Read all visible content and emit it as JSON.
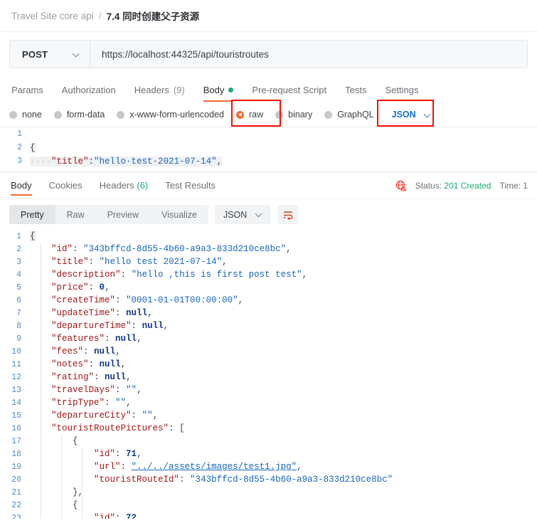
{
  "breadcrumb": {
    "root": "Travel Site core api",
    "separator": "/",
    "current": "7.4 同时创建父子资源"
  },
  "request": {
    "method": "POST",
    "url": "https://localhost:44325/api/touristroutes",
    "tabs": [
      {
        "label": "Params",
        "active": false
      },
      {
        "label": "Authorization",
        "active": false
      },
      {
        "label": "Headers",
        "count": "(9)",
        "active": false
      },
      {
        "label": "Body",
        "active": true,
        "dot": true
      },
      {
        "label": "Pre-request Script",
        "active": false
      },
      {
        "label": "Tests",
        "active": false
      },
      {
        "label": "Settings",
        "active": false
      }
    ],
    "body_types": [
      {
        "label": "none",
        "selected": false
      },
      {
        "label": "form-data",
        "selected": false
      },
      {
        "label": "x-www-form-urlencoded",
        "selected": false
      },
      {
        "label": "raw",
        "selected": true
      },
      {
        "label": "binary",
        "selected": false
      },
      {
        "label": "GraphQL",
        "selected": false
      }
    ],
    "format_selected": "JSON",
    "editor_lines": [
      {
        "num": "1",
        "text": ""
      },
      {
        "num": "2",
        "text": "{"
      },
      {
        "num": "3",
        "indent": "····",
        "key": "\"title\"",
        "colon": ":",
        "value": "\"hello·test·2021-07-14\"",
        "comma": ","
      }
    ]
  },
  "response": {
    "tabs": [
      {
        "label": "Body",
        "active": true
      },
      {
        "label": "Cookies",
        "active": false
      },
      {
        "label": "Headers",
        "count": "(6)",
        "active": false
      },
      {
        "label": "Test Results",
        "active": false
      }
    ],
    "status_prefix": "Status: ",
    "status_value": "201 Created",
    "time_text": "Time: 1",
    "view_modes": [
      {
        "label": "Pretty",
        "active": true
      },
      {
        "label": "Raw",
        "active": false
      },
      {
        "label": "Preview",
        "active": false
      },
      {
        "label": "Visualize",
        "active": false
      }
    ],
    "format_selected": "JSON",
    "lines": [
      {
        "num": "1",
        "tokens": [
          {
            "t": "{",
            "c": "p brace-hl"
          }
        ]
      },
      {
        "num": "2",
        "tokens": [
          {
            "t": "    ",
            "c": "p"
          },
          {
            "t": "\"id\"",
            "c": "k"
          },
          {
            "t": ": ",
            "c": "p"
          },
          {
            "t": "\"343bffcd-8d55-4b60-a9a3-833d210ce8bc\"",
            "c": "s"
          },
          {
            "t": ",",
            "c": "p"
          }
        ]
      },
      {
        "num": "3",
        "tokens": [
          {
            "t": "    ",
            "c": "p"
          },
          {
            "t": "\"title\"",
            "c": "k"
          },
          {
            "t": ": ",
            "c": "p"
          },
          {
            "t": "\"hello test 2021-07-14\"",
            "c": "s"
          },
          {
            "t": ",",
            "c": "p"
          }
        ]
      },
      {
        "num": "4",
        "tokens": [
          {
            "t": "    ",
            "c": "p"
          },
          {
            "t": "\"description\"",
            "c": "k"
          },
          {
            "t": ": ",
            "c": "p"
          },
          {
            "t": "\"hello ,this is first post test\"",
            "c": "s"
          },
          {
            "t": ",",
            "c": "p"
          }
        ]
      },
      {
        "num": "5",
        "tokens": [
          {
            "t": "    ",
            "c": "p"
          },
          {
            "t": "\"price\"",
            "c": "k"
          },
          {
            "t": ": ",
            "c": "p"
          },
          {
            "t": "0",
            "c": "n"
          },
          {
            "t": ",",
            "c": "p"
          }
        ]
      },
      {
        "num": "6",
        "tokens": [
          {
            "t": "    ",
            "c": "p"
          },
          {
            "t": "\"createTime\"",
            "c": "k"
          },
          {
            "t": ": ",
            "c": "p"
          },
          {
            "t": "\"0001-01-01T00:00:00\"",
            "c": "s"
          },
          {
            "t": ",",
            "c": "p"
          }
        ]
      },
      {
        "num": "7",
        "tokens": [
          {
            "t": "    ",
            "c": "p"
          },
          {
            "t": "\"updateTime\"",
            "c": "k"
          },
          {
            "t": ": ",
            "c": "p"
          },
          {
            "t": "null",
            "c": "nul"
          },
          {
            "t": ",",
            "c": "p"
          }
        ]
      },
      {
        "num": "8",
        "tokens": [
          {
            "t": "    ",
            "c": "p"
          },
          {
            "t": "\"departureTime\"",
            "c": "k"
          },
          {
            "t": ": ",
            "c": "p"
          },
          {
            "t": "null",
            "c": "nul"
          },
          {
            "t": ",",
            "c": "p"
          }
        ]
      },
      {
        "num": "9",
        "tokens": [
          {
            "t": "    ",
            "c": "p"
          },
          {
            "t": "\"features\"",
            "c": "k"
          },
          {
            "t": ": ",
            "c": "p"
          },
          {
            "t": "null",
            "c": "nul"
          },
          {
            "t": ",",
            "c": "p"
          }
        ]
      },
      {
        "num": "10",
        "tokens": [
          {
            "t": "    ",
            "c": "p"
          },
          {
            "t": "\"fees\"",
            "c": "k"
          },
          {
            "t": ": ",
            "c": "p"
          },
          {
            "t": "null",
            "c": "nul"
          },
          {
            "t": ",",
            "c": "p"
          }
        ]
      },
      {
        "num": "11",
        "tokens": [
          {
            "t": "    ",
            "c": "p"
          },
          {
            "t": "\"notes\"",
            "c": "k"
          },
          {
            "t": ": ",
            "c": "p"
          },
          {
            "t": "null",
            "c": "nul"
          },
          {
            "t": ",",
            "c": "p"
          }
        ]
      },
      {
        "num": "12",
        "tokens": [
          {
            "t": "    ",
            "c": "p"
          },
          {
            "t": "\"rating\"",
            "c": "k"
          },
          {
            "t": ": ",
            "c": "p"
          },
          {
            "t": "null",
            "c": "nul"
          },
          {
            "t": ",",
            "c": "p"
          }
        ]
      },
      {
        "num": "13",
        "tokens": [
          {
            "t": "    ",
            "c": "p"
          },
          {
            "t": "\"travelDays\"",
            "c": "k"
          },
          {
            "t": ": ",
            "c": "p"
          },
          {
            "t": "\"\"",
            "c": "s"
          },
          {
            "t": ",",
            "c": "p"
          }
        ]
      },
      {
        "num": "14",
        "tokens": [
          {
            "t": "    ",
            "c": "p"
          },
          {
            "t": "\"tripType\"",
            "c": "k"
          },
          {
            "t": ": ",
            "c": "p"
          },
          {
            "t": "\"\"",
            "c": "s"
          },
          {
            "t": ",",
            "c": "p"
          }
        ]
      },
      {
        "num": "15",
        "tokens": [
          {
            "t": "    ",
            "c": "p"
          },
          {
            "t": "\"departureCity\"",
            "c": "k"
          },
          {
            "t": ": ",
            "c": "p"
          },
          {
            "t": "\"\"",
            "c": "s"
          },
          {
            "t": ",",
            "c": "p"
          }
        ]
      },
      {
        "num": "16",
        "tokens": [
          {
            "t": "    ",
            "c": "p"
          },
          {
            "t": "\"touristRoutePictures\"",
            "c": "k"
          },
          {
            "t": ": ",
            "c": "p"
          },
          {
            "t": "[",
            "c": "p"
          }
        ]
      },
      {
        "num": "17",
        "tokens": [
          {
            "t": "        ",
            "c": "p"
          },
          {
            "t": "{",
            "c": "p"
          }
        ]
      },
      {
        "num": "18",
        "tokens": [
          {
            "t": "            ",
            "c": "p"
          },
          {
            "t": "\"id\"",
            "c": "k"
          },
          {
            "t": ": ",
            "c": "p"
          },
          {
            "t": "71",
            "c": "n"
          },
          {
            "t": ",",
            "c": "p"
          }
        ]
      },
      {
        "num": "19",
        "tokens": [
          {
            "t": "            ",
            "c": "p"
          },
          {
            "t": "\"url\"",
            "c": "k"
          },
          {
            "t": ": ",
            "c": "p"
          },
          {
            "t": "\"../../assets/images/test1.jpg\"",
            "c": "s ul"
          },
          {
            "t": ",",
            "c": "p"
          }
        ]
      },
      {
        "num": "20",
        "tokens": [
          {
            "t": "            ",
            "c": "p"
          },
          {
            "t": "\"touristRouteId\"",
            "c": "k"
          },
          {
            "t": ": ",
            "c": "p"
          },
          {
            "t": "\"343bffcd-8d55-4b60-a9a3-833d210ce8bc\"",
            "c": "s"
          }
        ]
      },
      {
        "num": "21",
        "tokens": [
          {
            "t": "        ",
            "c": "p"
          },
          {
            "t": "}",
            "c": "p"
          },
          {
            "t": ",",
            "c": "p"
          }
        ]
      },
      {
        "num": "22",
        "tokens": [
          {
            "t": "        ",
            "c": "p"
          },
          {
            "t": "{",
            "c": "p"
          }
        ]
      },
      {
        "num": "23",
        "tokens": [
          {
            "t": "            ",
            "c": "p"
          },
          {
            "t": "\"id\"",
            "c": "k"
          },
          {
            "t": ": ",
            "c": "p"
          },
          {
            "t": "72",
            "c": "n"
          }
        ]
      }
    ]
  },
  "colors": {
    "accent_orange": "#ef6c33",
    "success_green": "#1bae70",
    "link_blue": "#0f6fd6",
    "annotation_red": "#fa0f00"
  }
}
